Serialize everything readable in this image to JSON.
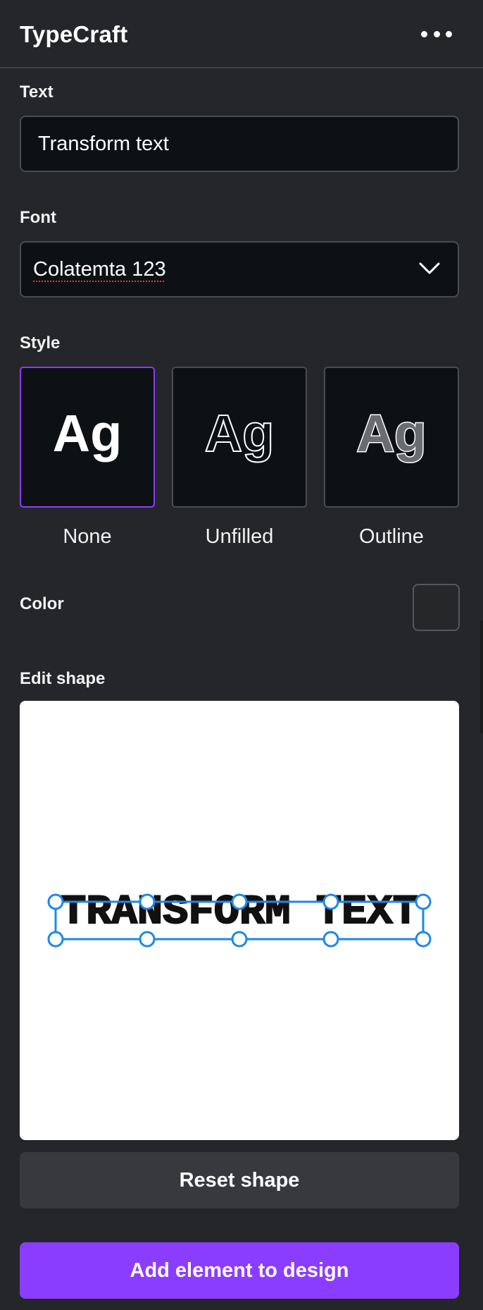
{
  "app": {
    "title": "TypeCraft",
    "more_icon": "more-horizontal-icon"
  },
  "text_section": {
    "label": "Text",
    "value": "Transform text"
  },
  "font_section": {
    "label": "Font",
    "selected": "Colatemta 123",
    "dropdown_icon": "chevron-down-icon"
  },
  "style_section": {
    "label": "Style",
    "options": [
      {
        "sample": "Ag",
        "caption": "None",
        "selected": true
      },
      {
        "sample": "Ag",
        "caption": "Unfilled",
        "selected": false
      },
      {
        "sample": "Ag",
        "caption": "Outline",
        "selected": false
      }
    ]
  },
  "color_section": {
    "label": "Color",
    "swatch_color": "#262729"
  },
  "shape_section": {
    "label": "Edit shape",
    "preview_text": "TRANSFORM TEXT"
  },
  "buttons": {
    "reset": "Reset shape",
    "add": "Add element to design"
  },
  "colors": {
    "background": "#252629",
    "input_bg": "#0e1114",
    "accent": "#8b3dff",
    "handle": "#1e88e5"
  }
}
